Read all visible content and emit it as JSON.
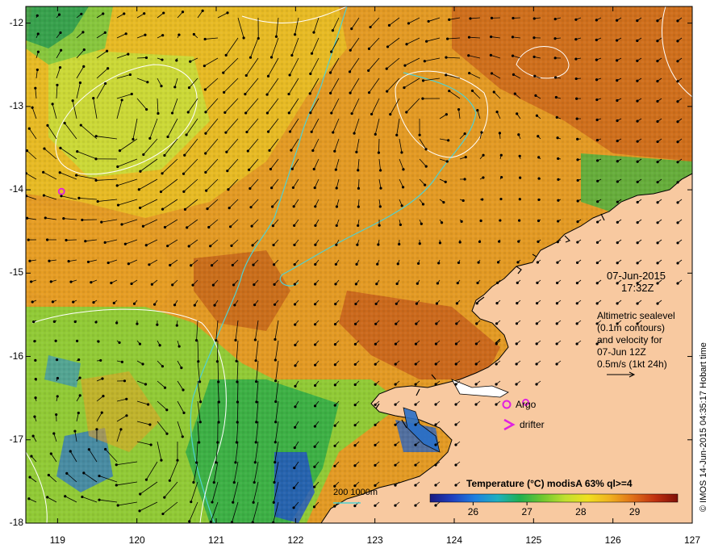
{
  "map": {
    "lon_ticks": [
      "119",
      "120",
      "121",
      "122",
      "123",
      "124",
      "125",
      "126",
      "127"
    ],
    "lat_ticks": [
      "-12",
      "-13",
      "-14",
      "-15",
      "-16",
      "-17",
      "-18"
    ],
    "lon_range": [
      118.6,
      127.0
    ],
    "lat_range": [
      -11.8,
      -18.0
    ],
    "colors": {
      "land": "#f8c9a0",
      "coast": "#000000",
      "contour_200_1000m": "#4fd2d2",
      "sealevel_contour": "#ffffff",
      "argo": "#e020e0",
      "drifter": "#e020e0",
      "sst_warm": "#e08a1a",
      "sst_hot": "#b84a10",
      "sst_mid": "#f0c020",
      "sst_cool": "#a8d840",
      "sst_cold": "#30a040",
      "sst_coldest": "#2050d0"
    }
  },
  "annotations": {
    "date": "07-Jun-2015",
    "time": "17:32Z",
    "altimetry_lines": [
      "Altimetric sealevel",
      "(0.1m contours)",
      "and velocity for",
      "07-Jun 12Z",
      "0.5m/s (1kt 24h)"
    ],
    "argo_label": "Argo",
    "drifter_label": "drifter",
    "isobath_label": "200  1000m",
    "credit": "© IMOS 14-Jun-2015 04:35:17 Hobart time"
  },
  "colorbar": {
    "title": "Temperature (°C) modisA 63% ql>=4",
    "ticks": [
      "26",
      "27",
      "28",
      "29"
    ],
    "tick_values": [
      26,
      27,
      28,
      29
    ],
    "range": [
      25.2,
      29.8
    ],
    "colors": [
      "#1a1a80",
      "#2040c0",
      "#2080e0",
      "#20b0c0",
      "#20b050",
      "#70c830",
      "#c0e030",
      "#f0e020",
      "#f0b020",
      "#e07018",
      "#c03010",
      "#801008"
    ]
  },
  "argo_floats": [
    {
      "lon": 119.05,
      "lat": -14.02
    },
    {
      "lon": 124.9,
      "lat": -16.55
    }
  ]
}
